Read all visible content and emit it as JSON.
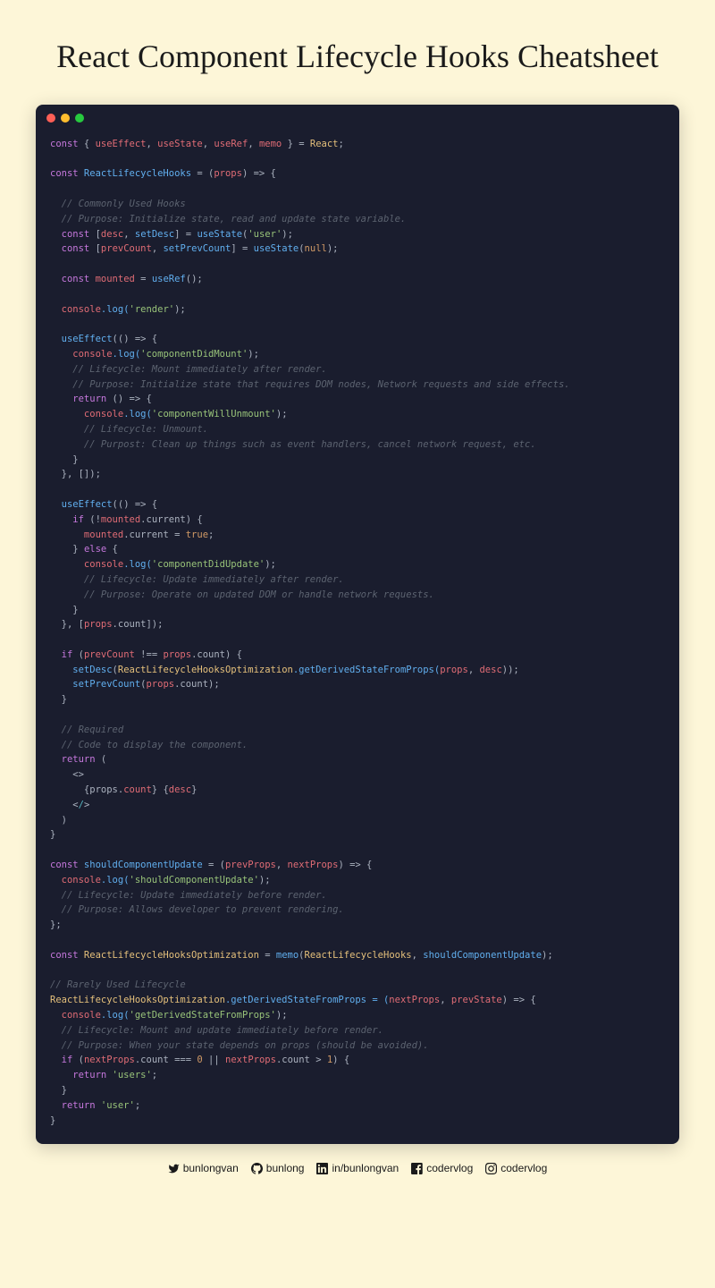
{
  "title": "React Component Lifecycle Hooks Cheatsheet",
  "code": {
    "l1_const": "const",
    "l1_brace_open": " { ",
    "l1_useEffect": "useEffect",
    "l1_sep1": ", ",
    "l1_useState": "useState",
    "l1_sep2": ", ",
    "l1_useRef": "useRef",
    "l1_sep3": ", ",
    "l1_memo": "memo",
    "l1_brace_close": " } = ",
    "l1_React": "React",
    "l1_semi": ";",
    "l3_const": "const",
    "l3_name": " ReactLifecycleHooks",
    "l3_eq": " = (",
    "l3_props": "props",
    "l3_arrow": ") => {",
    "l5_cmt": "  // Commonly Used Hooks",
    "l6_cmt": "  // Purpose: Initialize state, read and update state variable.",
    "l7_const": "  const",
    "l7_bracket": " [",
    "l7_desc": "desc",
    "l7_comma": ", ",
    "l7_setDesc": "setDesc",
    "l7_bracket_close": "] = ",
    "l7_useState": "useState",
    "l7_paren": "(",
    "l7_str": "'user'",
    "l7_end": ");",
    "l8_const": "  const",
    "l8_bracket": " [",
    "l8_prevCount": "prevCount",
    "l8_comma": ", ",
    "l8_setPrevCount": "setPrevCount",
    "l8_bracket_close": "] = ",
    "l8_useState": "useState",
    "l8_paren": "(",
    "l8_null": "null",
    "l8_end": ");",
    "l10_const": "  const",
    "l10_mounted": " mounted",
    "l10_eq": " = ",
    "l10_useRef": "useRef",
    "l10_end": "();",
    "l12_console": "  console",
    "l12_log": ".log(",
    "l12_str": "'render'",
    "l12_end": ");",
    "l14_useEffect": "  useEffect",
    "l14_arrow": "(() => {",
    "l15_console": "    console",
    "l15_log": ".log(",
    "l15_str": "'componentDidMount'",
    "l15_end": ");",
    "l16_cmt": "    // Lifecycle: Mount immediately after render.",
    "l17_cmt": "    // Purpose: Initialize state that requires DOM nodes, Network requests and side effects.",
    "l18_return": "    return",
    "l18_arrow": " () => {",
    "l19_console": "      console",
    "l19_log": ".log(",
    "l19_str": "'componentWillUnmount'",
    "l19_end": ");",
    "l20_cmt": "      // Lifecycle: Unmount.",
    "l21_cmt": "      // Purpost: Clean up things such as event handlers, cancel network request, etc.",
    "l22_brace": "    }",
    "l23_end": "  }, []);",
    "l25_useEffect": "  useEffect",
    "l25_arrow": "(() => {",
    "l26_if": "    if",
    "l26_cond": " (!",
    "l26_mounted": "mounted",
    "l26_current": ".current) {",
    "l27_mounted": "      mounted",
    "l27_current": ".current = ",
    "l27_true": "true",
    "l27_semi": ";",
    "l28_else": "    } ",
    "l28_else_kw": "else",
    "l28_brace": " {",
    "l29_console": "      console",
    "l29_log": ".log(",
    "l29_str": "'componentDidUpdate'",
    "l29_end": ");",
    "l30_cmt": "      // Lifecycle: Update immediately after render.",
    "l31_cmt": "      // Purpose: Operate on updated DOM or handle network requests.",
    "l32_brace": "    }",
    "l33_end_a": "  }, [",
    "l33_props": "props",
    "l33_count": ".count]);",
    "l35_if": "  if",
    "l35_paren": " (",
    "l35_prevCount": "prevCount",
    "l35_neq": " !== ",
    "l35_props": "props",
    "l35_count": ".count) {",
    "l36_setDesc": "    setDesc",
    "l36_paren": "(",
    "l36_cls": "ReactLifecycleHooksOptimization",
    "l36_method": ".getDerivedStateFromProps(",
    "l36_props": "props",
    "l36_comma": ", ",
    "l36_desc": "desc",
    "l36_end": "));",
    "l37_setPrevCount": "    setPrevCount",
    "l37_paren": "(",
    "l37_props": "props",
    "l37_count": ".count);",
    "l38_brace": "  }",
    "l40_cmt": "  // Required",
    "l41_cmt": "  // Code to display the component.",
    "l42_return": "  return",
    "l42_paren": " (",
    "l43_frag": "    <>",
    "l44_indent": "      {props.",
    "l44_count": "count",
    "l44_mid": "} {",
    "l44_desc": "desc",
    "l44_end": "}",
    "l45_frag_close": "    <",
    "l45_slash": "/",
    "l45_gt": ">",
    "l46_paren": "  )",
    "l47_brace": "}",
    "l49_const": "const",
    "l49_name": " shouldComponentUpdate",
    "l49_eq": " = (",
    "l49_prevProps": "prevProps",
    "l49_comma": ", ",
    "l49_nextProps": "nextProps",
    "l49_arrow": ") => {",
    "l50_console": "  console",
    "l50_log": ".log(",
    "l50_str": "'shouldComponentUpdate'",
    "l50_end": ");",
    "l51_cmt": "  // Lifecycle: Update immediately before render.",
    "l52_cmt": "  // Purpose: Allows developer to prevent rendering.",
    "l53_brace": "};",
    "l55_const": "const",
    "l55_name": " ReactLifecycleHooksOptimization",
    "l55_eq": " = ",
    "l55_memo": "memo",
    "l55_paren": "(",
    "l55_arg1": "ReactLifecycleHooks",
    "l55_comma": ", ",
    "l55_arg2": "shouldComponentUpdate",
    "l55_end": ");",
    "l57_cmt": "// Rarely Used Lifecycle",
    "l58_cls": "ReactLifecycleHooksOptimization",
    "l58_method": ".getDerivedStateFromProps = (",
    "l58_nextProps": "nextProps",
    "l58_comma": ", ",
    "l58_prevState": "prevState",
    "l58_arrow": ") => {",
    "l59_console": "  console",
    "l59_log": ".log(",
    "l59_str": "'getDerivedStateFromProps'",
    "l59_end": ");",
    "l60_cmt": "  // Lifecycle: Mount and update immediately before render.",
    "l61_cmt": "  // Purpose: When your state depends on props (should be avoided).",
    "l62_if": "  if",
    "l62_paren": " (",
    "l62_nextProps": "nextProps",
    "l62_count1": ".count === ",
    "l62_zero": "0",
    "l62_or": " || ",
    "l62_nextProps2": "nextProps",
    "l62_count2": ".count > ",
    "l62_one": "1",
    "l62_brace": ") {",
    "l63_return": "    return",
    "l63_str": " 'users'",
    "l63_semi": ";",
    "l64_brace": "  }",
    "l65_return": "  return",
    "l65_str": " 'user'",
    "l65_semi": ";",
    "l66_brace": "}"
  },
  "footer": {
    "twitter": "bunlongvan",
    "github": "bunlong",
    "linkedin": "in/bunlongvan",
    "facebook": "codervlog",
    "instagram": "codervlog"
  }
}
